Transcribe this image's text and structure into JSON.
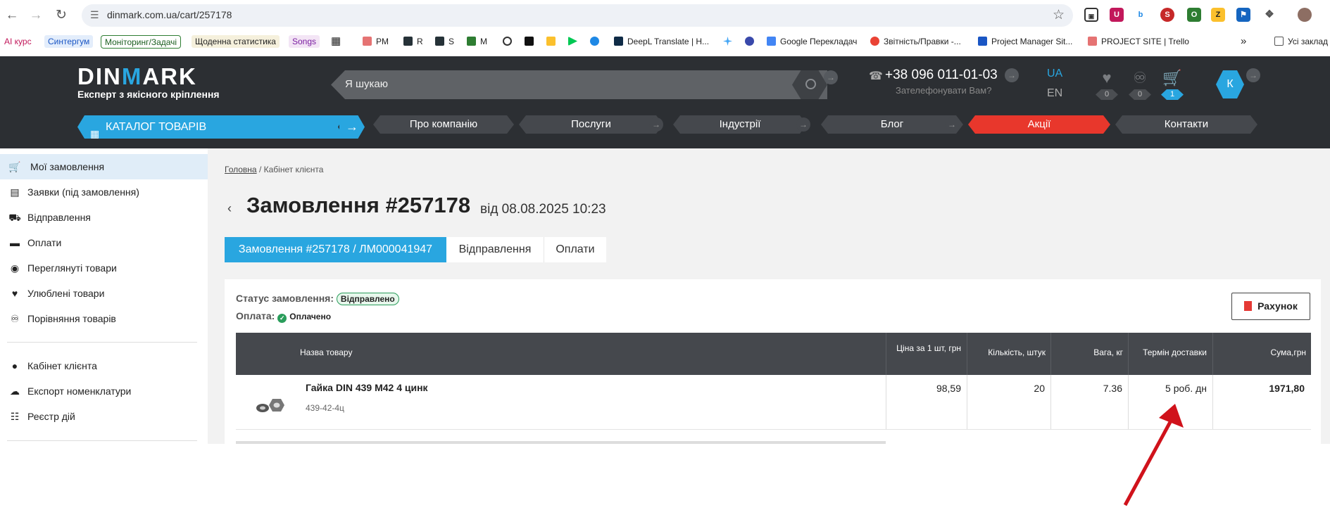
{
  "browser": {
    "url": "dinmark.com.ua/cart/257178",
    "bookmarks": [
      "AI курс",
      "Синтергум",
      "Моніторинг/Задачі",
      "Щоденна статистика",
      "Songs",
      "PM",
      "R",
      "S",
      "M",
      "DeepL Translate | H...",
      "Google Перекладач",
      "Звітність/Правки -...",
      "Project Manager Sit...",
      "PROJECT SITE | Trello",
      "Усі заклад"
    ],
    "overflow": "»"
  },
  "header": {
    "logo_main_a": "DIN",
    "logo_main_b": "M",
    "logo_main_c": "ARK",
    "logo_sub": "Експерт з якісного кріплення",
    "search_placeholder": "Я шукаю",
    "phone": "+38 096 011-01-03",
    "callback": "Зателефонувати Вам?",
    "lang_ua": "UA",
    "lang_en": "EN",
    "fav_count": "0",
    "compare_count": "0",
    "cart_count": "1",
    "avatar_letter": "К"
  },
  "menu": {
    "catalog": "КАТАЛОГ ТОВАРІВ",
    "items": [
      "Про компанію",
      "Послуги",
      "Індустрії",
      "Блог",
      "Акції",
      "Контакти"
    ]
  },
  "sidebar": {
    "items": [
      "Мої замовлення",
      "Заявки (під замовлення)",
      "Відправлення",
      "Оплати",
      "Переглянуті товари",
      "Улюблені товари",
      "Порівняння товарів"
    ],
    "items2": [
      "Кабінет клієнта",
      "Експорт номенклатури",
      "Реєстр дій"
    ]
  },
  "page": {
    "crumb_home": "Головна",
    "crumb_sep": "/",
    "crumb_current": "Кабінет клієнта",
    "title": "Замовлення #257178",
    "title_date": "від 08.08.2025 10:23",
    "tabs": [
      "Замовлення #257178 / ЛМ000041947",
      "Відправлення",
      "Оплати"
    ],
    "status_label": "Статус замовлення:",
    "status_value": "Відправлено",
    "payment_label": "Оплата:",
    "payment_value": "Оплачено",
    "invoice": "Рахунок"
  },
  "table": {
    "headers": [
      "Назва товару",
      "Ціна за 1 шт, грн",
      "Кількість, штук",
      "Вага, кг",
      "Термін доставки",
      "Сума,грн"
    ],
    "row": {
      "name": "Гайка DIN 439 M42 4 цинк",
      "sku": "439-42-4ц",
      "price": "98,59",
      "qty": "20",
      "weight": "7.36",
      "delivery": "5 роб. дн",
      "sum": "1971,80"
    }
  },
  "colors": {
    "accent": "#29a6e0",
    "header": "#2c2f33",
    "promo": "#e8372c",
    "arrow": "#d0121b"
  }
}
